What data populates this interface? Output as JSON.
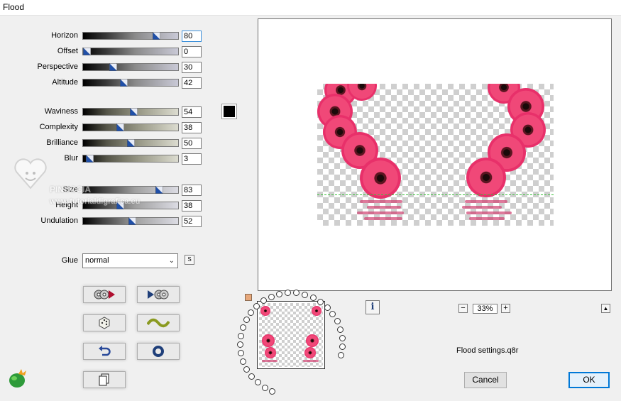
{
  "window": {
    "title": "Flood"
  },
  "sliders_group1": [
    {
      "label": "Horizon",
      "value": "80",
      "fraction": 0.8,
      "focused": true
    },
    {
      "label": "Offset",
      "value": "0",
      "fraction": 0.0
    },
    {
      "label": "Perspective",
      "value": "30",
      "fraction": 0.3
    },
    {
      "label": "Altitude",
      "value": "42",
      "fraction": 0.42
    }
  ],
  "sliders_group2": [
    {
      "label": "Waviness",
      "value": "54",
      "fraction": 0.54
    },
    {
      "label": "Complexity",
      "value": "38",
      "fraction": 0.38
    },
    {
      "label": "Brilliance",
      "value": "50",
      "fraction": 0.5
    },
    {
      "label": "Blur",
      "value": "3",
      "fraction": 0.03
    }
  ],
  "sliders_group3": [
    {
      "label": "Size",
      "value": "83",
      "fraction": 0.83
    },
    {
      "label": "Height",
      "value": "38",
      "fraction": 0.38
    },
    {
      "label": "Undulation",
      "value": "52",
      "fraction": 0.52
    }
  ],
  "color": {
    "swatch": "#000000"
  },
  "glue": {
    "label": "Glue",
    "value": "normal",
    "s_button": "S"
  },
  "watermark": {
    "line1": "PINUCCIA",
    "line2": "www.tutorialdigrafica.eu"
  },
  "preview": {
    "zoom": "33%",
    "info_icon": "i"
  },
  "footer": {
    "file_name": "Flood settings.q8r",
    "cancel": "Cancel",
    "ok": "OK"
  },
  "icons": [
    "load-preset-icon",
    "save-preset-icon",
    "randomize-dice-icon",
    "wave-icon",
    "undo-icon",
    "reset-ring-icon",
    "copy-icon",
    "app-logo-icon"
  ],
  "colors": {
    "accent": "#0078d7",
    "flower_pink": "#e8306a",
    "slider_thumb": "#1f4fa8"
  }
}
